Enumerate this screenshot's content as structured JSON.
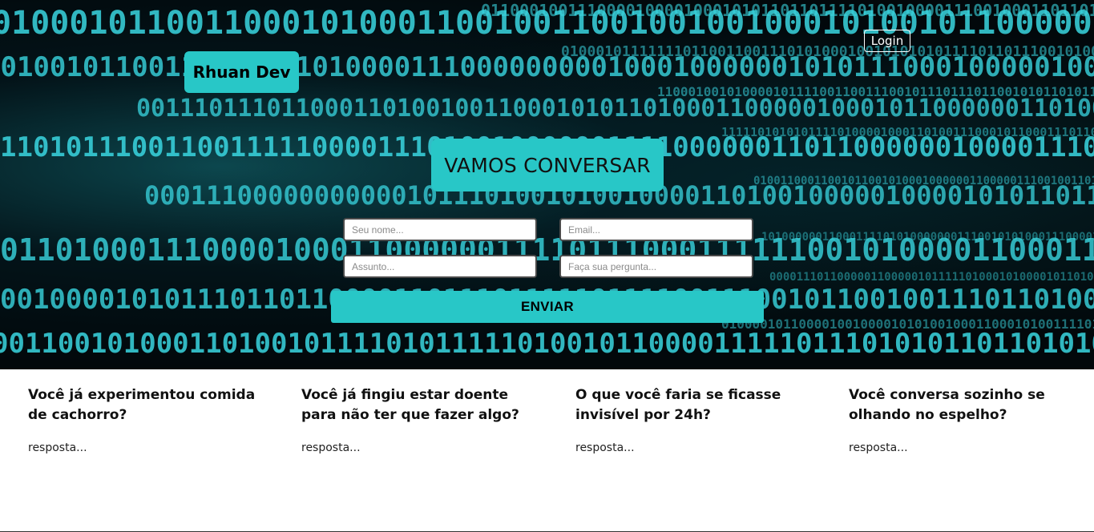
{
  "header": {
    "brand": "Rhuan Dev",
    "login_label": "Login"
  },
  "contact": {
    "title": "VAMOS CONVERSAR",
    "name_placeholder": "Seu nome...",
    "email_placeholder": "Email...",
    "subject_placeholder": "Assunto...",
    "question_placeholder": "Faça sua pergunta...",
    "submit_label": "ENVIAR"
  },
  "faq": {
    "items": [
      {
        "question": "Você já experimentou comida de cachorro?",
        "answer": "resposta..."
      },
      {
        "question": "Você já fingiu estar doente para não ter que fazer algo?",
        "answer": "resposta..."
      },
      {
        "question": "O que você faria se ficasse invisível por 24h?",
        "answer": "resposta..."
      },
      {
        "question": "Você conversa sozinho se olhando no espelho?",
        "answer": "resposta..."
      }
    ]
  },
  "colors": {
    "accent": "#28c7c7",
    "hero_background": "#02080b",
    "binary_text": "#3ad6e0"
  }
}
